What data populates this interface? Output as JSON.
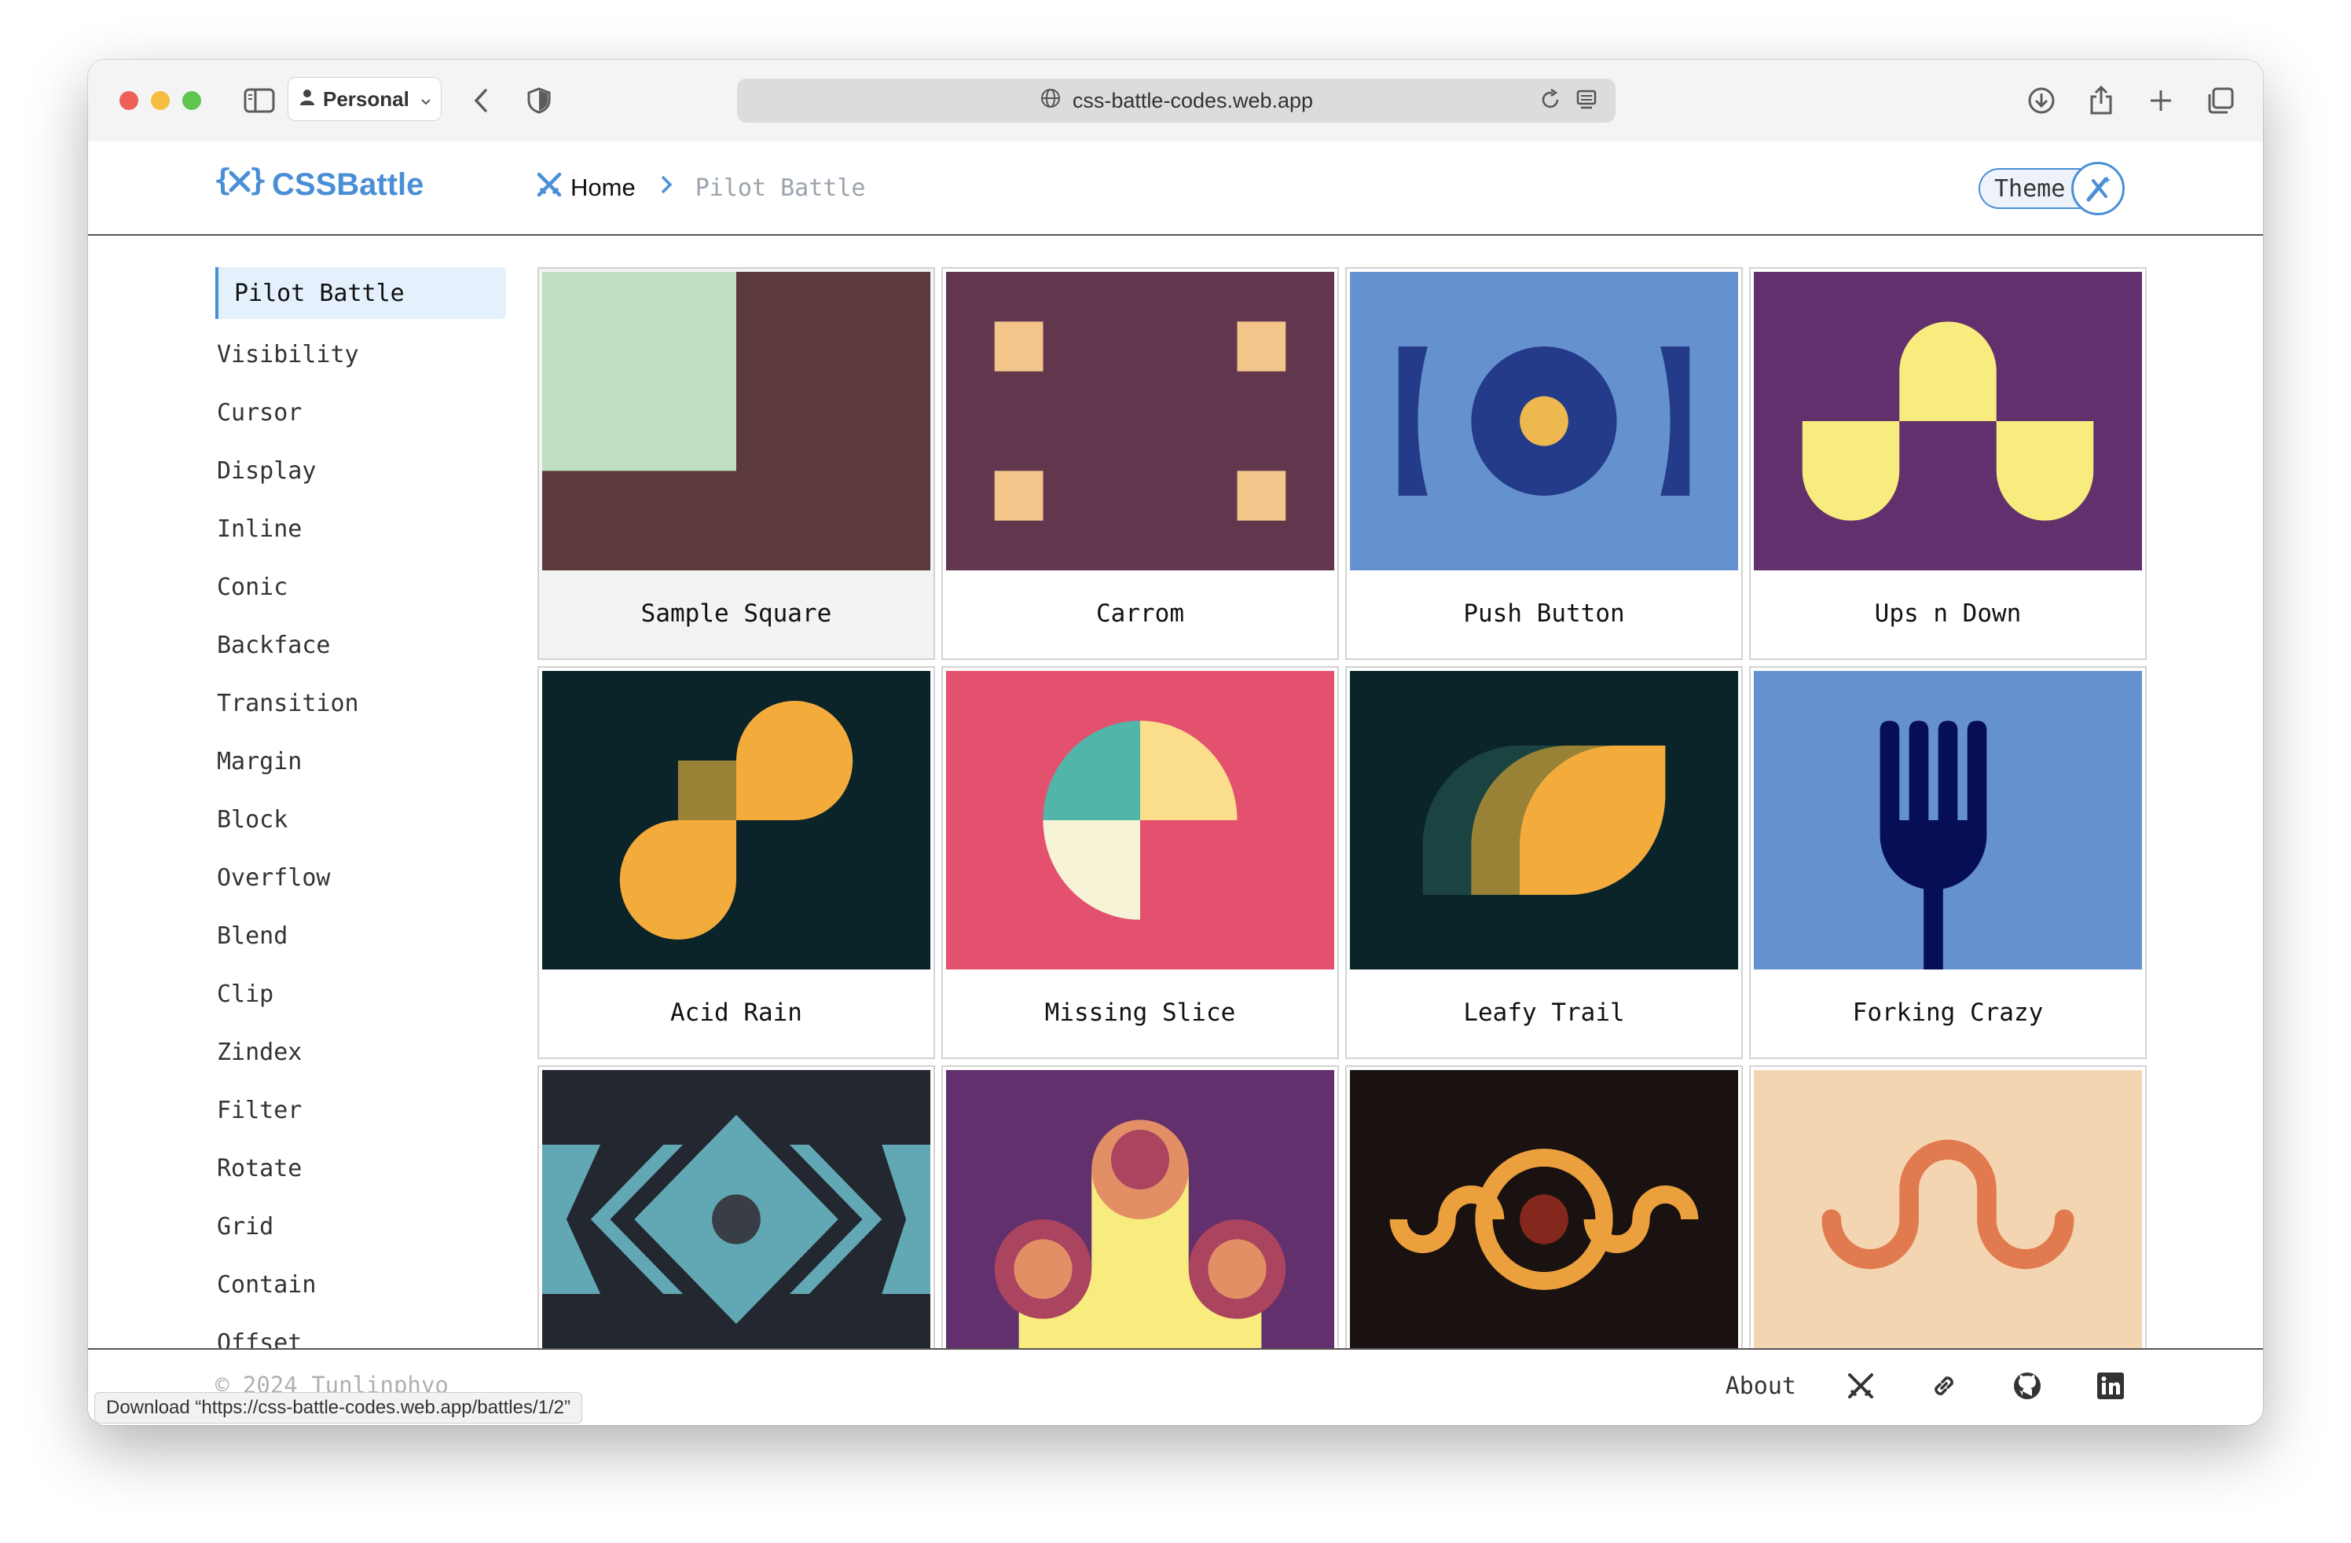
{
  "browser": {
    "profile_label": "Personal",
    "url": "css-battle-codes.web.app"
  },
  "header": {
    "logo_text": "CSSBattle",
    "breadcrumb_home": "Home",
    "breadcrumb_current": "Pilot Battle",
    "theme_label": "Theme"
  },
  "sidebar": {
    "items": [
      "Pilot Battle",
      "Visibility",
      "Cursor",
      "Display",
      "Inline",
      "Conic",
      "Backface",
      "Transition",
      "Margin",
      "Block",
      "Overflow",
      "Blend",
      "Clip",
      "Zindex",
      "Filter",
      "Rotate",
      "Grid",
      "Contain",
      "Offset"
    ],
    "active": "Pilot Battle"
  },
  "cards": [
    {
      "title": "Sample Square",
      "bg": "#5c3a3b"
    },
    {
      "title": "Carrom",
      "bg": "#62374e"
    },
    {
      "title": "Push Button",
      "bg": "#6592cf"
    },
    {
      "title": "Ups n Down",
      "bg": "#62306d"
    },
    {
      "title": "Acid Rain",
      "bg": "#0b2429"
    },
    {
      "title": "Missing Slice",
      "bg": "#e3516e"
    },
    {
      "title": "Leafy Trail",
      "bg": "#0b2429"
    },
    {
      "title": "Forking Crazy",
      "bg": "#6592cf"
    },
    {
      "title": "",
      "bg": "#222730"
    },
    {
      "title": "",
      "bg": "#62306d"
    },
    {
      "title": "",
      "bg": "#191210"
    },
    {
      "title": "",
      "bg": "#f3d5b2"
    }
  ],
  "footer": {
    "copyright": "© 2024 Tunlinphyo",
    "about": "About"
  },
  "status_bar": "Download “https://css-battle-codes.web.app/battles/1/2”"
}
